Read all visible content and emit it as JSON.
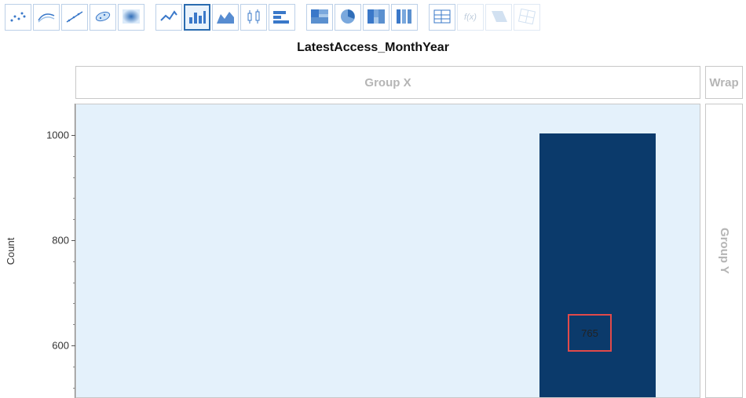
{
  "toolbar": {
    "groups": [
      [
        "scatter-icon",
        "contour-icon",
        "scatter-line-icon",
        "density-ellipse-icon",
        "heatmap-icon"
      ],
      [
        "line-chart-icon",
        "bar-chart-icon",
        "area-chart-icon",
        "boxplot-icon",
        "hbar-icon"
      ],
      [
        "treemap-icon",
        "pie-chart-icon",
        "mosaic-icon",
        "packed-bars-icon"
      ],
      [
        "table-icon",
        "function-icon",
        "parallel-icon",
        "rotated-grid-icon"
      ]
    ],
    "selected": "bar-chart-icon",
    "disabled": [
      "function-icon",
      "parallel-icon",
      "rotated-grid-icon"
    ]
  },
  "chart": {
    "title": "LatestAccess_MonthYear",
    "group_x_label": "Group X",
    "group_y_label": "Group Y",
    "wrap_label": "Wrap",
    "y_axis_label": "Count",
    "highlighted_label": "765"
  },
  "chart_data": {
    "type": "bar",
    "ylabel": "Count",
    "title": "LatestAccess_MonthYear",
    "ylim": [
      500,
      1000
    ],
    "y_ticks": [
      600,
      800,
      1000
    ],
    "categories": [
      "(visible bar)"
    ],
    "values": [
      1005
    ],
    "annotations": [
      {
        "text": "765",
        "y": 610
      }
    ]
  }
}
